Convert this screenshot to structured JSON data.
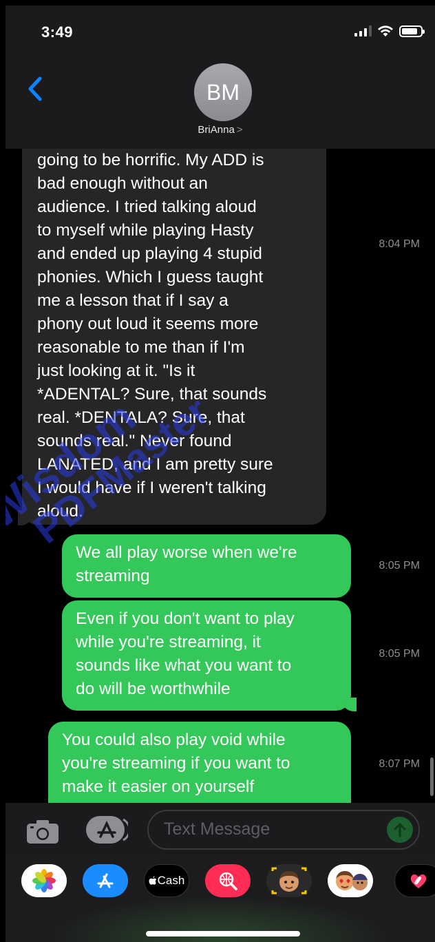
{
  "status_bar": {
    "time": "3:49"
  },
  "header": {
    "avatar_initials": "BM",
    "contact_name": "BriAnna",
    "contact_chevron": ">"
  },
  "messages": [
    {
      "direction": "incoming",
      "text": "going to be horrific. My ADD is\nbad enough without an\naudience. I tried talking aloud\nto myself while playing Hasty\nand ended up playing 4 stupid\nphonies. Which I guess taught\nme a lesson that if I say a\nphony out loud it seems more\nreasonable to me than if I'm\njust looking at it. \"Is it\n*ADENTAL? Sure, that sounds\nreal. *DENTALA? Sure, that\nsounds real.\" Never found\nLANATED, and I am pretty sure\nI would have if I weren't talking\naloud.",
      "time": "8:04 PM"
    },
    {
      "direction": "outgoing",
      "text": "We all play worse when we're\nstreaming",
      "time": "8:05 PM"
    },
    {
      "direction": "outgoing",
      "text": "Even if you don't want to play\nwhile you're streaming, it\nsounds like what you want to\ndo will be worthwhile",
      "time": "8:05 PM"
    },
    {
      "direction": "outgoing",
      "text": "You could also play void while\nyou're streaming if you want to\nmake it easier on yourself",
      "time": "8:07 PM"
    }
  ],
  "input": {
    "placeholder": "Text Message"
  },
  "app_drawer": {
    "apps": [
      {
        "name": "photos-app-icon"
      },
      {
        "name": "app-store-icon"
      },
      {
        "name": "apple-cash-app",
        "label": "Cash"
      },
      {
        "name": "web-search-icon"
      },
      {
        "name": "memoji-icon"
      },
      {
        "name": "memoji-stickers-icon"
      },
      {
        "name": "digital-touch-icon"
      }
    ]
  },
  "watermark": {
    "line1": "Wisdom",
    "line2": "PDFMaster"
  },
  "colors": {
    "outgoing_bubble": "#34c759",
    "incoming_bubble": "#262628",
    "accent_blue": "#0a84ff",
    "timestamp": "#8e8e93"
  }
}
